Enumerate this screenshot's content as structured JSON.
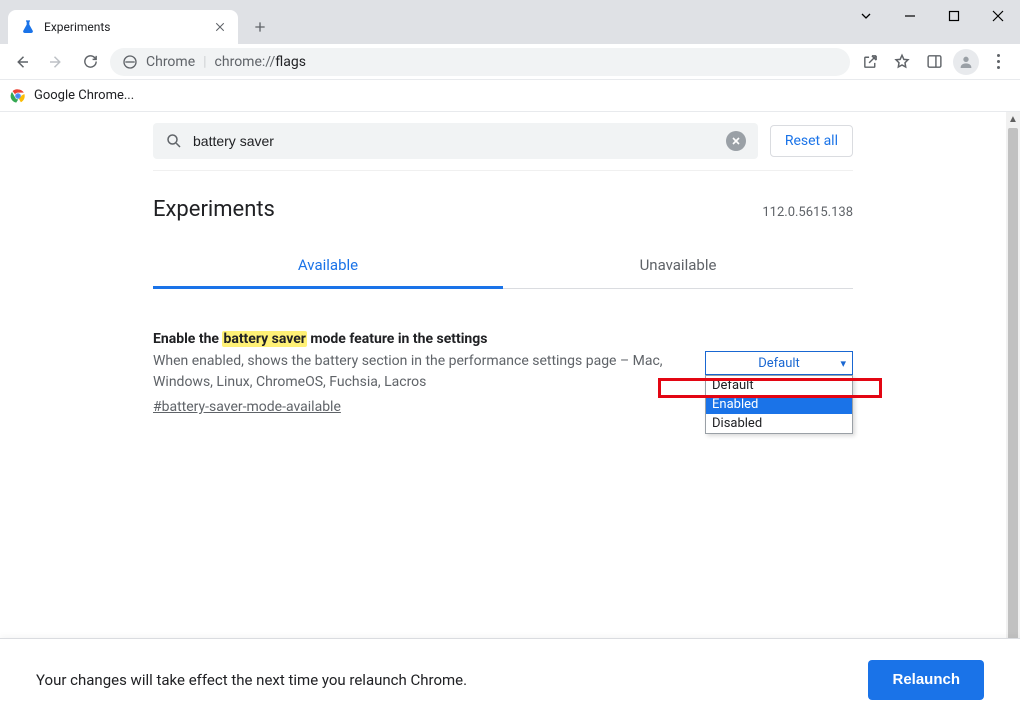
{
  "window": {
    "tab_title": "Experiments"
  },
  "toolbar": {
    "site_label": "Chrome",
    "url_prefix": "chrome://",
    "url_path": "flags"
  },
  "bookmarks": {
    "item0": "Google Chrome..."
  },
  "search": {
    "value": "battery saver",
    "reset_label": "Reset all"
  },
  "page": {
    "title": "Experiments",
    "version": "112.0.5615.138",
    "tabs": {
      "available": "Available",
      "unavailable": "Unavailable"
    }
  },
  "flag": {
    "title_pre": "Enable the ",
    "title_hl": "battery saver",
    "title_post": " mode feature in the settings",
    "desc": "When enabled, shows the battery section in the performance settings page – Mac, Windows, Linux, ChromeOS, Fuchsia, Lacros",
    "anchor": "#battery-saver-mode-available",
    "select": {
      "current": "Default",
      "options": {
        "o0": "Default",
        "o1": "Enabled",
        "o2": "Disabled"
      }
    }
  },
  "footer": {
    "msg": "Your changes will take effect the next time you relaunch Chrome.",
    "relaunch": "Relaunch"
  }
}
